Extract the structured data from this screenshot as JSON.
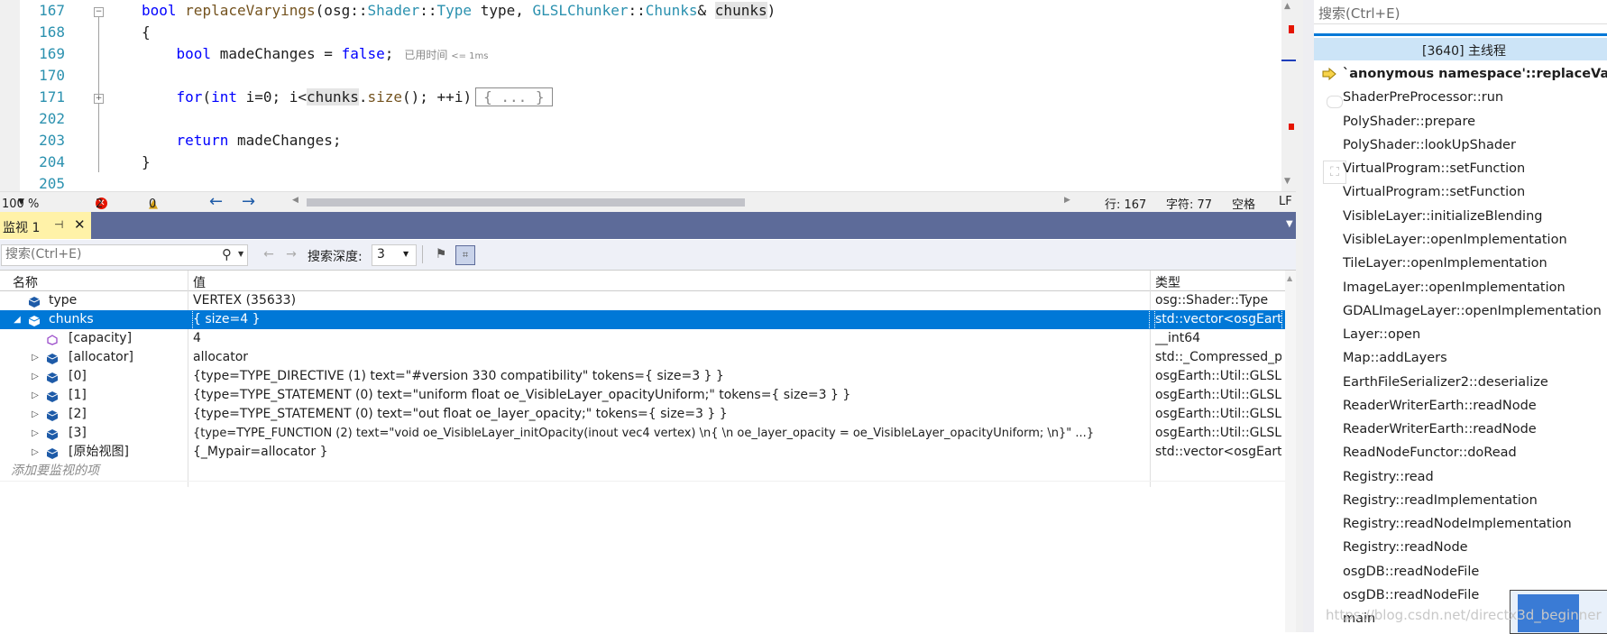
{
  "editor": {
    "lines": [
      {
        "num": "167"
      },
      {
        "num": "168"
      },
      {
        "num": "169"
      },
      {
        "num": "170"
      },
      {
        "num": "171"
      },
      {
        "num": "202"
      },
      {
        "num": "203"
      },
      {
        "num": "204"
      },
      {
        "num": "205"
      }
    ],
    "code": {
      "l167_kw": "bool",
      "l167_fn": "replaceVaryings",
      "l167_a": "(osg::",
      "l167_shader": "Shader",
      "l167_b": "::",
      "l167_type": "Type",
      "l167_c": " type, ",
      "l167_glsl": "GLSLChunker",
      "l167_d": "::",
      "l167_chunksT": "Chunks",
      "l167_e": "& ",
      "l167_chunks": "chunks",
      "l167_f": ")",
      "l168": "{",
      "l169_kw": "bool",
      "l169_a": " madeChanges = ",
      "l169_false": "false",
      "l169_b": ";",
      "l169_perf": "已用时间",
      "l169_perf_small": "<= 1ms",
      "l171_kw": "for",
      "l171_a": "(",
      "l171_int": "int",
      "l171_b": " i=0; i<",
      "l171_chunks": "chunks",
      "l171_c": ".",
      "l171_size": "size",
      "l171_d": "(); ++i)",
      "l171_collapsed": "{ ... }",
      "l203_kw": "return",
      "l203_a": " madeChanges;",
      "l204": "}"
    },
    "status": {
      "zoom": "100 %",
      "errors": "2",
      "warnings": "0",
      "line": "行: 167",
      "char": "字符: 77",
      "spaces": "空格",
      "eol": "LF"
    }
  },
  "watch": {
    "tab_title": "监视 1",
    "search_placeholder": "搜索(Ctrl+E)",
    "depth_label": "搜索深度:",
    "depth_value": "3",
    "columns": {
      "name": "名称",
      "value": "值",
      "type": "类型"
    },
    "rows": [
      {
        "name": "type",
        "value": "VERTEX (35633)",
        "type": "osg::Shader::Type"
      },
      {
        "name": "chunks",
        "value": "{ size=4 }",
        "type": "std::vector<osgEart..."
      },
      {
        "name": "[capacity]",
        "value": "4",
        "type": "__int64"
      },
      {
        "name": "[allocator]",
        "value": "allocator",
        "type": "std::_Compressed_p..."
      },
      {
        "name": "[0]",
        "value": "{type=TYPE_DIRECTIVE (1) text=\"#version 330 compatibility\" tokens={ size=3 } }",
        "type": "osgEarth::Util::GLSL..."
      },
      {
        "name": "[1]",
        "value": "{type=TYPE_STATEMENT (0) text=\"uniform float oe_VisibleLayer_opacityUniform;\" tokens={ size=3 } }",
        "type": "osgEarth::Util::GLSL..."
      },
      {
        "name": "[2]",
        "value": "{type=TYPE_STATEMENT (0) text=\"out float oe_layer_opacity;\" tokens={ size=3 } }",
        "type": "osgEarth::Util::GLSL..."
      },
      {
        "name": "[3]",
        "value": "{type=TYPE_FUNCTION (2) text=\"void oe_VisibleLayer_initOpacity(inout vec4 vertex) \\n{ \\n    oe_layer_opacity = oe_VisibleLayer_opacityUniform; \\n}\" ...}",
        "type": "osgEarth::Util::GLSL..."
      },
      {
        "name": "[原始视图]",
        "value": "{_Mypair=allocator }",
        "type": "std::vector<osgEart..."
      }
    ],
    "add_watch": "添加要监视的项"
  },
  "callstack": {
    "search_placeholder": "搜索(Ctrl+E)",
    "thread": "[3640] 主线程",
    "frames": [
      "`anonymous namespace'::replaceVaryings",
      "ShaderPreProcessor::run",
      "PolyShader::prepare",
      "PolyShader::lookUpShader",
      "VirtualProgram::setFunction",
      "VirtualProgram::setFunction",
      "VisibleLayer::initializeBlending",
      "VisibleLayer::openImplementation",
      "TileLayer::openImplementation",
      "ImageLayer::openImplementation",
      "GDALImageLayer::openImplementation",
      "Layer::open",
      "Map::addLayers",
      "EarthFileSerializer2::deserialize",
      "ReaderWriterEarth::readNode",
      "ReaderWriterEarth::readNode",
      "ReadNodeFunctor::doRead",
      "Registry::read",
      "Registry::readImplementation",
      "Registry::readNodeImplementation",
      "Registry::readNode",
      "osgDB::readNodeFile",
      "osgDB::readNodeFile",
      "main"
    ],
    "watermark": "https://blog.csdn.net/directx3d_beginner"
  },
  "colors": {
    "selection": "#0078d7",
    "tab_active": "#fff2a8",
    "title_bar": "#5d6b99",
    "thread_row": "#cce4f7"
  }
}
